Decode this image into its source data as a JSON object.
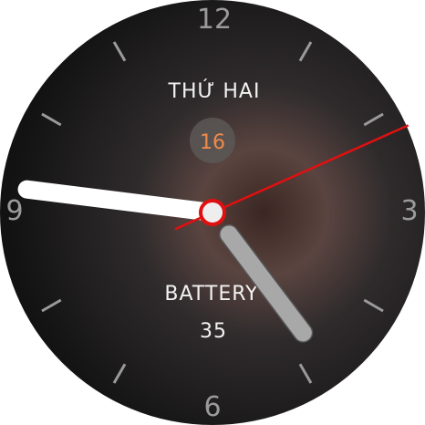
{
  "day_label": "THỨ HAI",
  "date": "16",
  "battery_label": "BATTERY",
  "battery_value": "35",
  "numerals": {
    "twelve": "12",
    "three": "3",
    "six": "6",
    "nine": "9"
  },
  "time": {
    "hour": 4,
    "minute": 46,
    "second": 11
  },
  "colors": {
    "date": "#f08a4b",
    "second_hand": "#e01010",
    "minute_hand": "#ffffff",
    "hour_hand": "#a8a8a8",
    "ticks": "#9a9a9a"
  }
}
